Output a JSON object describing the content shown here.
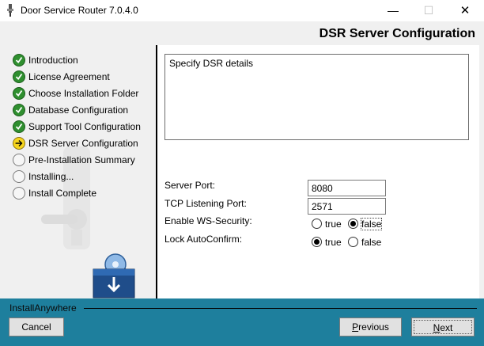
{
  "window": {
    "title": "Door Service Router 7.0.4.0",
    "minimize_glyph": "—",
    "maximize_glyph": "☐",
    "close_glyph": "✕",
    "app_icon": "door-lock-icon"
  },
  "header": {
    "title": "DSR Server Configuration"
  },
  "steps": [
    {
      "label": "Introduction",
      "status": "done"
    },
    {
      "label": "License Agreement",
      "status": "done"
    },
    {
      "label": "Choose Installation Folder",
      "status": "done"
    },
    {
      "label": "Database Configuration",
      "status": "done"
    },
    {
      "label": "Support Tool Configuration",
      "status": "done"
    },
    {
      "label": "DSR Server Configuration",
      "status": "current"
    },
    {
      "label": "Pre-Installation Summary",
      "status": "pending"
    },
    {
      "label": "Installing...",
      "status": "pending"
    },
    {
      "label": "Install Complete",
      "status": "pending"
    }
  ],
  "content": {
    "description": "Specify DSR details",
    "server_port": {
      "label": "Server Port:",
      "value": "8080"
    },
    "tcp_port": {
      "label": "TCP Listening Port:",
      "value": "2571"
    },
    "ws_security": {
      "label": "Enable WS-Security:",
      "true_label": "true",
      "false_label": "false",
      "selected": "false"
    },
    "lock_autoconfirm": {
      "label": "Lock AutoConfirm:",
      "true_label": "true",
      "false_label": "false",
      "selected": "true"
    }
  },
  "footer": {
    "brand": "InstallAnywhere",
    "cancel_label": "Cancel",
    "previous_label": "Previous",
    "next_label": "Next"
  },
  "colors": {
    "accent_bar": "#1e7f9d",
    "step_done": "#2f8f2f",
    "step_current": "#f6d51e"
  }
}
